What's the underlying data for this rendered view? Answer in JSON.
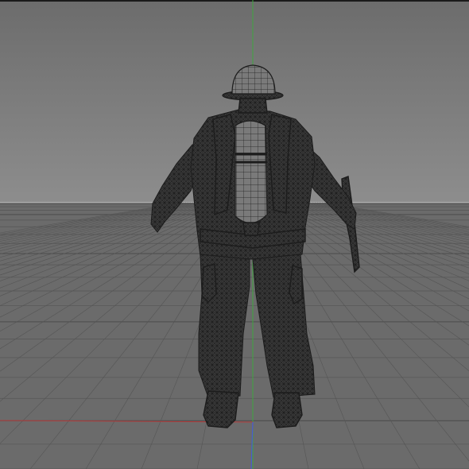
{
  "viewport": {
    "colors": {
      "top_border": "#1a1a1a",
      "sky_top": "#6c6c6c",
      "sky_bottom": "#8d8d8d",
      "horizon": "#b4b4b4",
      "floor": "#6b6b6b",
      "grid": "#555555",
      "grid_major": "#4b4b4b",
      "axis_x": "#b43a3a",
      "axis_y": "#3fa53f",
      "axis_z": "#4a5ad2",
      "mesh_fill": "#3a3a3a",
      "mesh_fill_light": "#7a7a7a",
      "wire": "#1c1c1c"
    }
  },
  "model": {
    "icon": "wireframe-firefighter-mesh",
    "parts": [
      "helmet",
      "air-tank",
      "jacket",
      "left-arm",
      "right-arm",
      "axe",
      "belt",
      "trousers",
      "left-boot",
      "right-boot"
    ]
  }
}
